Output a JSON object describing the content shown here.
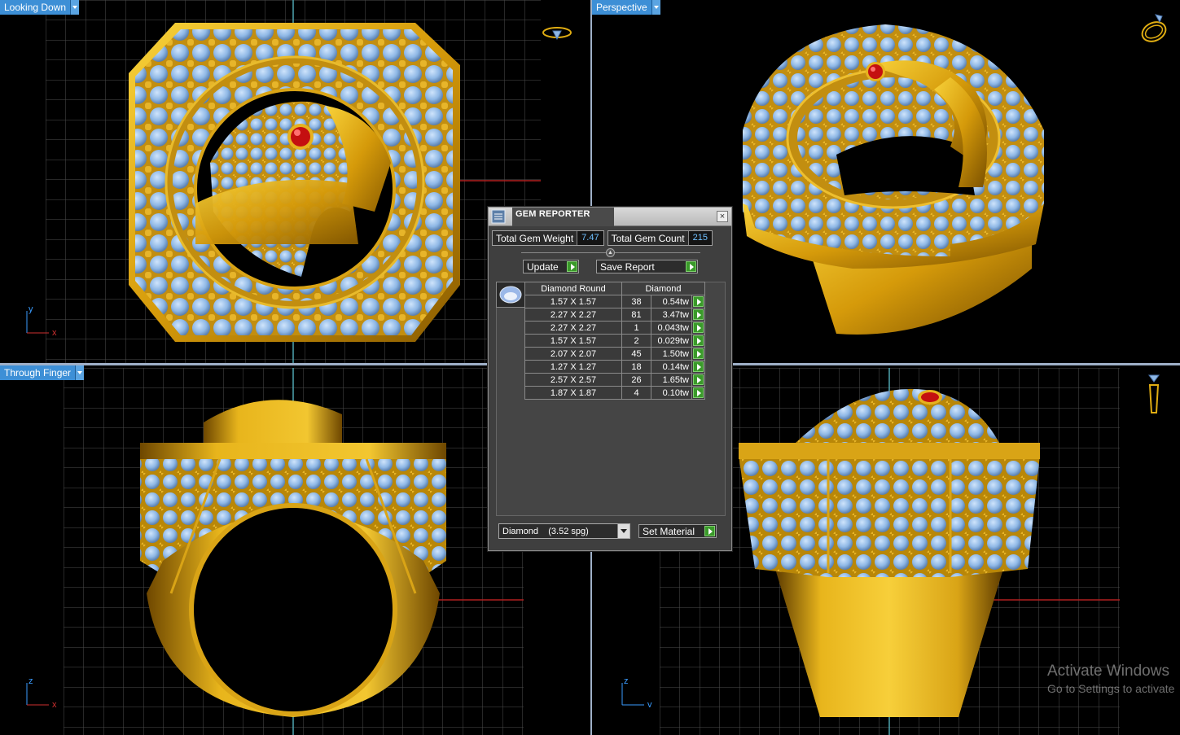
{
  "viewports": {
    "top_left": {
      "label": "Looking Down",
      "axes": [
        "y",
        "x"
      ]
    },
    "top_right": {
      "label": "Perspective"
    },
    "bottom_left": {
      "label": "Through Finger",
      "axes": [
        "z",
        "x"
      ]
    },
    "bottom_right": {
      "label": "",
      "axes": [
        "z",
        "y"
      ]
    }
  },
  "colors": {
    "gold": "#e0ad12",
    "gem_blue": "#8fb8e6",
    "ruby": "#cc1010",
    "grid": "#555555",
    "label_bg": "#3d8fd6"
  },
  "gem_reporter": {
    "title": "GEM REPORTER",
    "total_weight_label": "Total Gem Weight",
    "total_weight_value": "7.47",
    "total_count_label": "Total Gem Count",
    "total_count_value": "215",
    "update_label": "Update",
    "save_label": "Save Report",
    "table_headers": {
      "shape": "Diamond Round",
      "material": "Diamond"
    },
    "rows": [
      {
        "size": "1.57 X 1.57",
        "count": "38",
        "weight": "0.54tw"
      },
      {
        "size": "2.27 X 2.27",
        "count": "81",
        "weight": "3.47tw"
      },
      {
        "size": "2.27 X 2.27",
        "count": "1",
        "weight": "0.043tw"
      },
      {
        "size": "1.57 X 1.57",
        "count": "2",
        "weight": "0.029tw"
      },
      {
        "size": "2.07 X 2.07",
        "count": "45",
        "weight": "1.50tw"
      },
      {
        "size": "1.27 X 1.27",
        "count": "18",
        "weight": "0.14tw"
      },
      {
        "size": "2.57 X 2.57",
        "count": "26",
        "weight": "1.65tw"
      },
      {
        "size": "1.87 X 1.87",
        "count": "4",
        "weight": "0.10tw"
      }
    ],
    "material_select": "Diamond    (3.52 spg)",
    "set_material_label": "Set Material"
  },
  "watermark": {
    "title": "Activate Windows",
    "subtitle": "Go to Settings to activate"
  }
}
